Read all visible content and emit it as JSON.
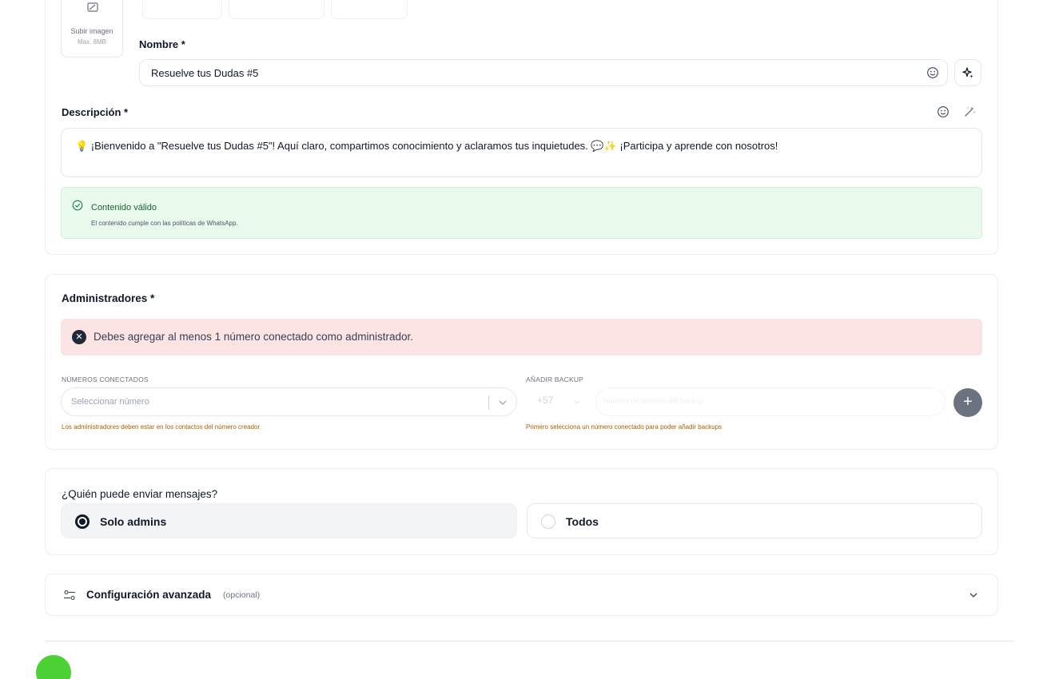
{
  "upload": {
    "label": "Subir imagen",
    "max": "Max. 8MB"
  },
  "name": {
    "label": "Nombre *",
    "value": "Resuelve tus Dudas #5"
  },
  "description": {
    "label": "Descripción *",
    "text": "💡 ¡Bienvenido a \"Resuelve tus Dudas #5\"! Aquí claro, compartimos conocimiento y aclaramos tus inquietudes. 💬✨ ¡Participa y aprende con nosotros!"
  },
  "validation": {
    "title": "Contenido válido",
    "subtitle": "El contenido cumple con las políticas de WhatsApp."
  },
  "admins": {
    "label": "Administradores *",
    "error": "Debes agregar al menos 1 número conectado como administrador.",
    "connected_label": "NÚMEROS CONECTADOS",
    "connected_placeholder": "Seleccionar número",
    "connected_hint": "Los administradores deben estar en los contactos del número creador",
    "backup_label": "AÑADIR BACKUP",
    "backup_prefix": "+57",
    "backup_placeholder": "Número de teléfono del backup",
    "backup_hint": "Primero selecciona un número conectado para poder añadir backups",
    "add_symbol": "+"
  },
  "send": {
    "label": "¿Quién puede enviar mensajes?",
    "options": [
      {
        "label": "Solo admins",
        "selected": true
      },
      {
        "label": "Todos",
        "selected": false
      }
    ]
  },
  "advanced": {
    "title": "Configuración avanzada",
    "optional": "(opcional)"
  },
  "colors": {
    "valid_bg": "#e9f9ec",
    "error_bg": "#fde4e4",
    "accent": "#4cd137"
  }
}
